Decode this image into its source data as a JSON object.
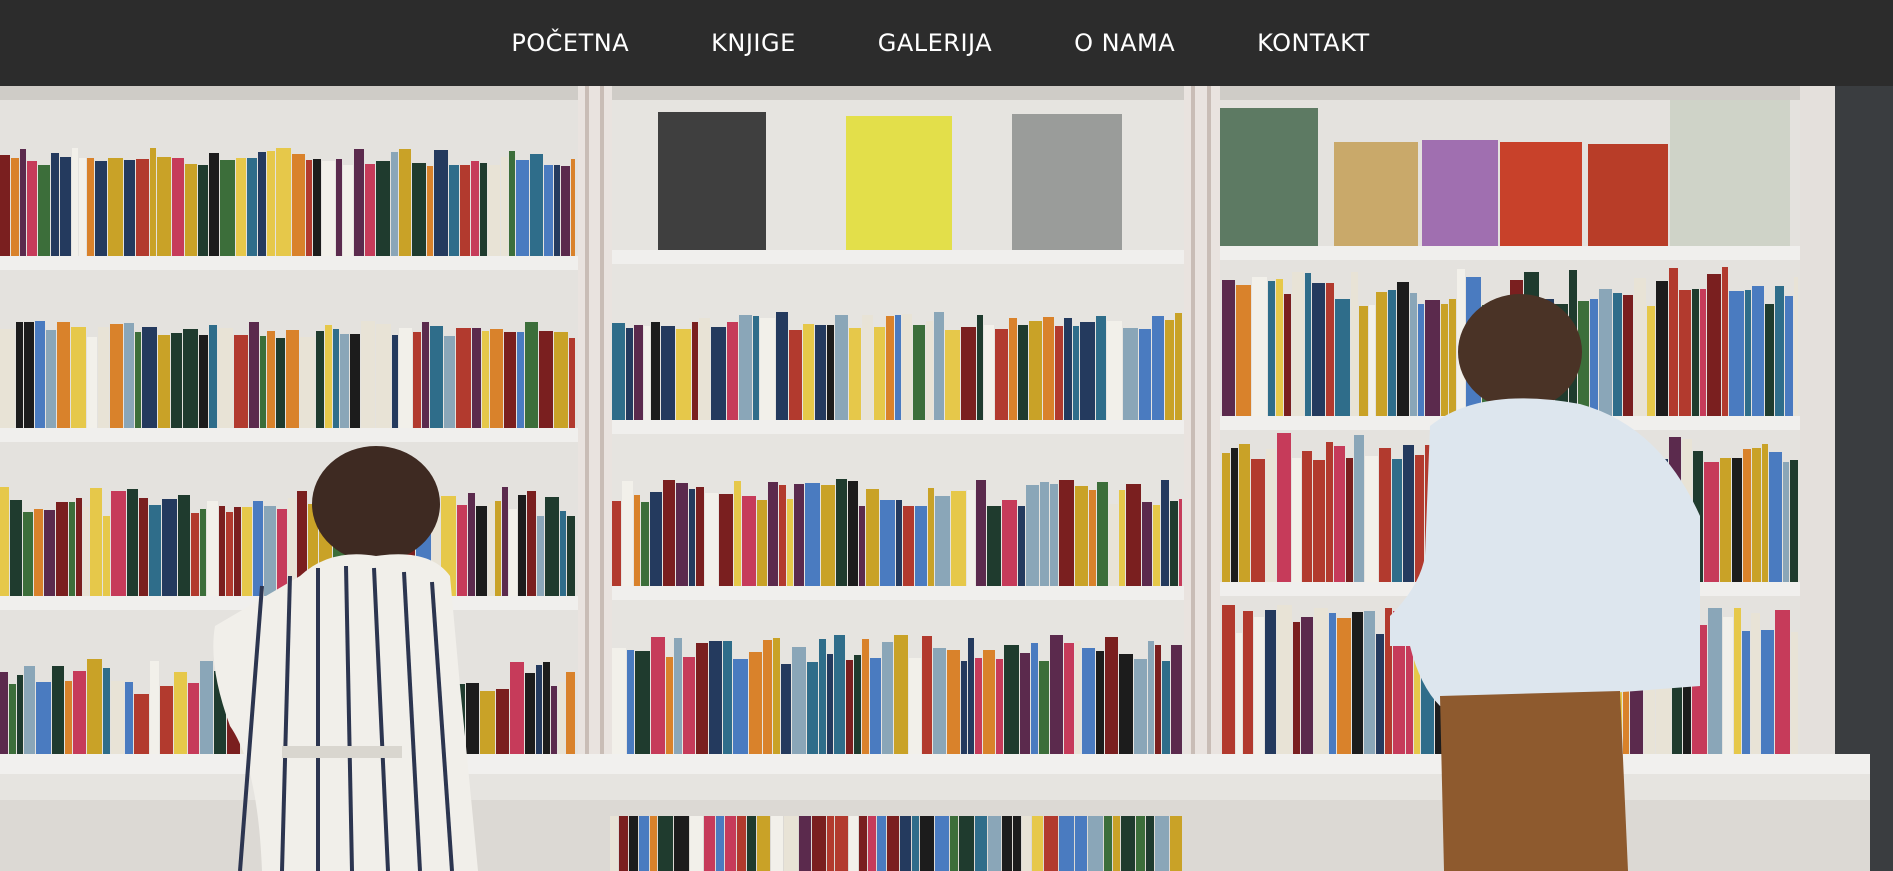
{
  "nav": {
    "items": [
      {
        "label": "POČETNA"
      },
      {
        "label": "KNJIGE"
      },
      {
        "label": "GALERIJA"
      },
      {
        "label": "O NAMA"
      },
      {
        "label": "KONTAKT"
      }
    ]
  },
  "colors": {
    "navbar_bg": "#2c2c2c",
    "nav_text": "#ffffff",
    "shelf_white": "#efeeec",
    "wall": "#d6d4d0"
  },
  "hero": {
    "icon": "bookshelf-photo"
  }
}
